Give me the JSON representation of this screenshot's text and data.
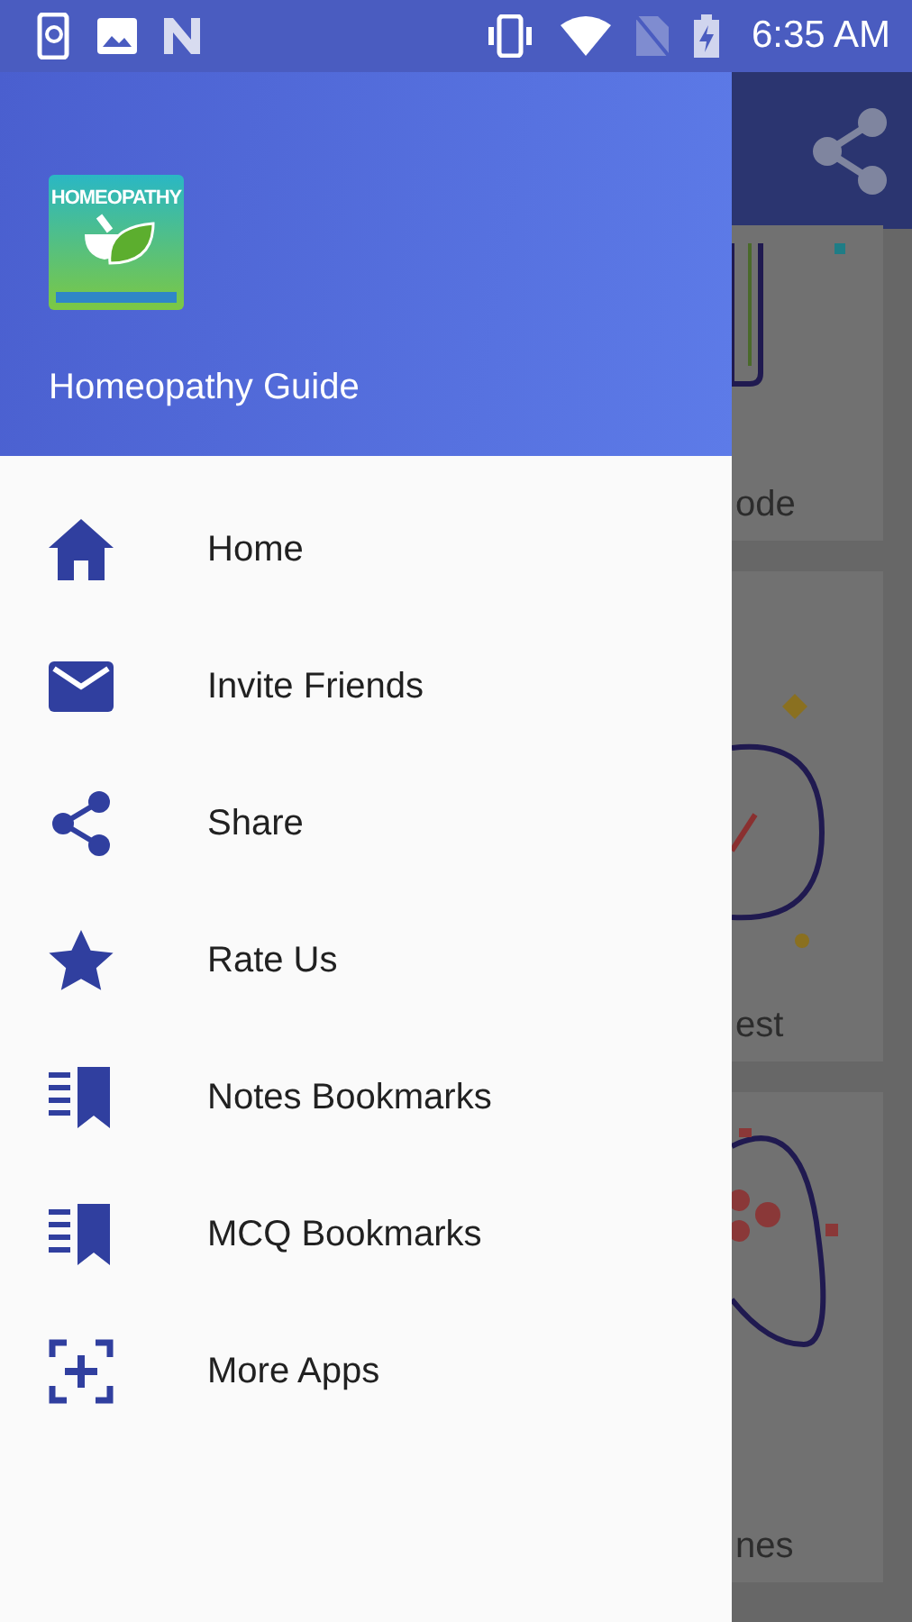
{
  "status_bar": {
    "time": "6:35 AM"
  },
  "background_cards": [
    {
      "label": "ode"
    },
    {
      "label": "est"
    },
    {
      "label": "nes"
    }
  ],
  "drawer": {
    "logo_text": "HOMEOPATHY",
    "title": "Homeopathy Guide",
    "items": [
      {
        "label": "Home"
      },
      {
        "label": "Invite Friends"
      },
      {
        "label": "Share"
      },
      {
        "label": "Rate Us"
      },
      {
        "label": "Notes Bookmarks"
      },
      {
        "label": "MCQ Bookmarks"
      },
      {
        "label": "More Apps"
      }
    ]
  }
}
